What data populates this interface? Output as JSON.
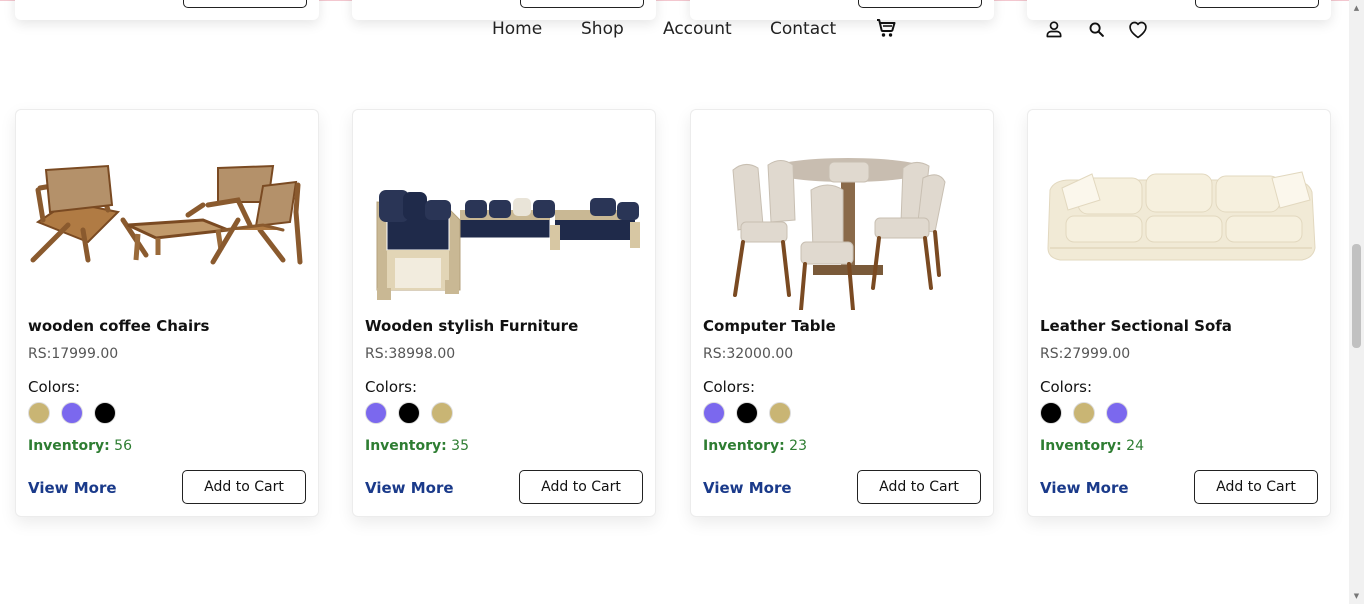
{
  "nav": {
    "home": "Home",
    "shop": "Shop",
    "account": "Account",
    "contact": "Contact"
  },
  "colors": {
    "gold": "#c9b574",
    "purple": "#7b68ee",
    "black": "#000000",
    "inventory_green": "#2e7d32",
    "link_blue": "#1a3a8a"
  },
  "products": [
    {
      "title": "wooden coffee Chairs",
      "price": "RS:17999.00",
      "colors_label": "Colors:",
      "swatches": [
        "#c9b574",
        "#7b68ee",
        "#000000"
      ],
      "inventory_label": "Inventory:",
      "inventory_value": "56",
      "view_more": "View More",
      "add_to_cart": "Add to Cart"
    },
    {
      "title": "Wooden stylish Furniture",
      "price": "RS:38998.00",
      "colors_label": "Colors:",
      "swatches": [
        "#7b68ee",
        "#000000",
        "#c9b574"
      ],
      "inventory_label": "Inventory:",
      "inventory_value": "35",
      "view_more": "View More",
      "add_to_cart": "Add to Cart"
    },
    {
      "title": "Computer Table",
      "price": "RS:32000.00",
      "colors_label": "Colors:",
      "swatches": [
        "#7b68ee",
        "#000000",
        "#c9b574"
      ],
      "inventory_label": "Inventory:",
      "inventory_value": "23",
      "view_more": "View More",
      "add_to_cart": "Add to Cart"
    },
    {
      "title": "Leather Sectional Sofa",
      "price": "RS:27999.00",
      "colors_label": "Colors:",
      "swatches": [
        "#000000",
        "#c9b574",
        "#7b68ee"
      ],
      "inventory_label": "Inventory:",
      "inventory_value": "24",
      "view_more": "View More",
      "add_to_cart": "Add to Cart"
    }
  ],
  "icons": {
    "cart": "cart-icon",
    "user": "user-icon",
    "search": "search-icon",
    "wishlist": "heart-icon"
  }
}
